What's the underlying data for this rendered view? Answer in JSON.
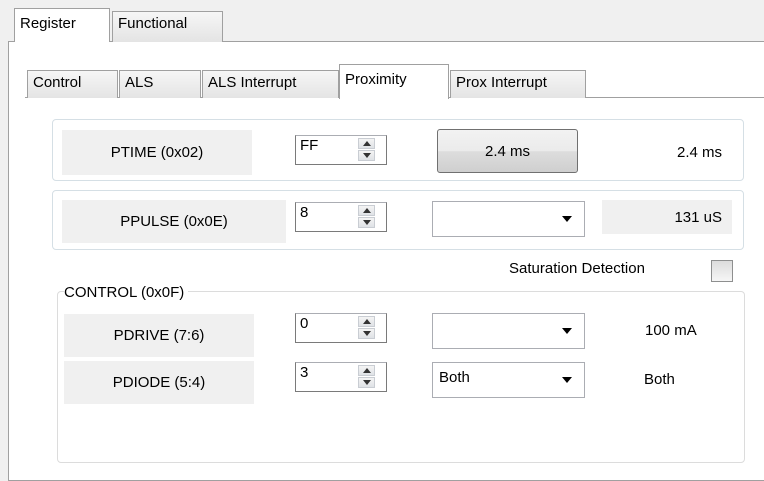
{
  "top_tabs": [
    "Register",
    "Functional"
  ],
  "sub_tabs": [
    "Control",
    "ALS",
    "ALS Interrupt",
    "Proximity",
    "Prox Interrupt"
  ],
  "ptime": {
    "label": "PTIME (0x02)",
    "value": "FF",
    "button_label": "2.4 ms",
    "result": "2.4 ms"
  },
  "ppulse": {
    "label": "PPULSE (0x0E)",
    "value": "8",
    "dropdown_value": "",
    "result": "131 uS"
  },
  "saturation": {
    "label": "Saturation Detection",
    "checked": false
  },
  "control": {
    "title": "CONTROL (0x0F)",
    "pdrive": {
      "label": "PDRIVE (7:6)",
      "value": "0",
      "dropdown_value": "",
      "result": "100 mA"
    },
    "pdiode": {
      "label": "PDIODE (5:4)",
      "value": "3",
      "dropdown_value": "Both",
      "result": "Both"
    }
  }
}
